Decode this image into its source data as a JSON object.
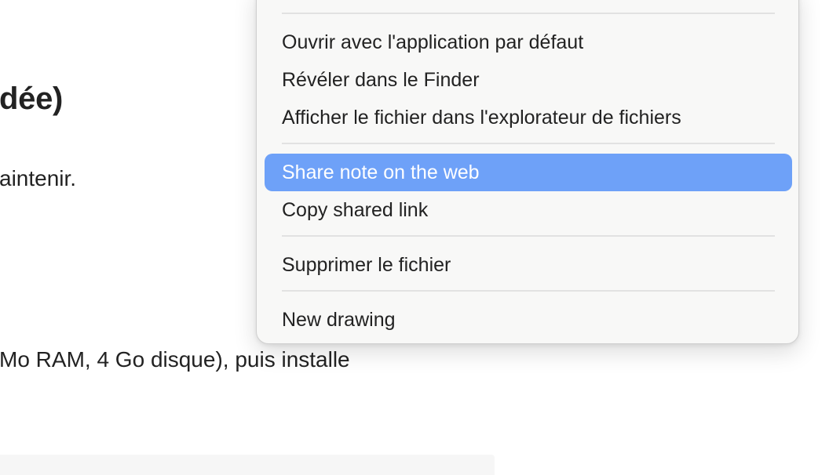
{
  "editor": {
    "heading": "dée)",
    "line1": "aintenir.",
    "line2": " Mo RAM, 4 Go disque), puis installe"
  },
  "context_menu": {
    "items": [
      {
        "label": "Ouvrir avec l'application par défaut"
      },
      {
        "label": "Révéler dans le Finder"
      },
      {
        "label": "Afficher le fichier dans l'explorateur de fichiers"
      },
      {
        "label": "Share note on the web",
        "highlighted": true
      },
      {
        "label": "Copy shared link"
      },
      {
        "label": "Supprimer le fichier"
      },
      {
        "label": "New drawing"
      }
    ],
    "highlight_color": "#6ea1f8"
  }
}
